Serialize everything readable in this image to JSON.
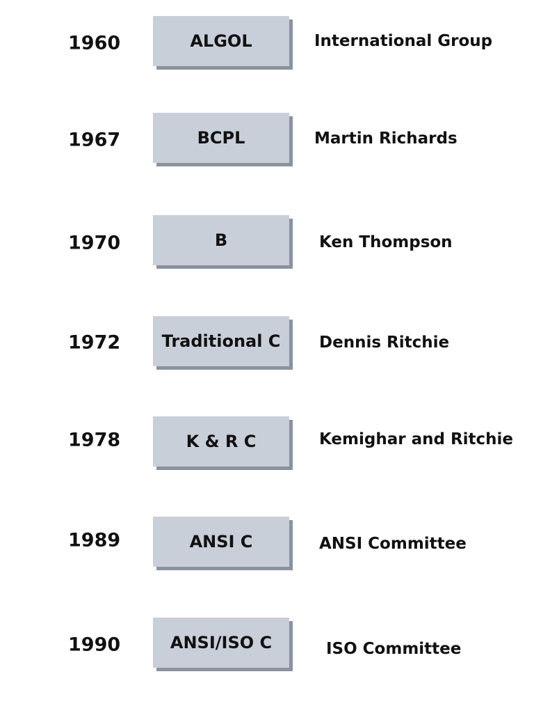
{
  "rows": [
    {
      "year": "1960",
      "language": "ALGOL",
      "creator": "International Group"
    },
    {
      "year": "1967",
      "language": "BCPL",
      "creator": "Martin Richards"
    },
    {
      "year": "1970",
      "language": "B",
      "creator": "Ken Thompson"
    },
    {
      "year": "1972",
      "language": "Traditional C",
      "creator": "Dennis Ritchie"
    },
    {
      "year": "1978",
      "language": "K & R C",
      "creator": "Kemighar and Ritchie"
    },
    {
      "year": "1989",
      "language": "ANSI C",
      "creator": "ANSI Committee"
    },
    {
      "year": "1990",
      "language": "ANSI/ISO C",
      "creator": "ISO Committee"
    }
  ],
  "colors": {
    "box_face": "#c9cfd9",
    "box_shadow": "#8a929d"
  }
}
